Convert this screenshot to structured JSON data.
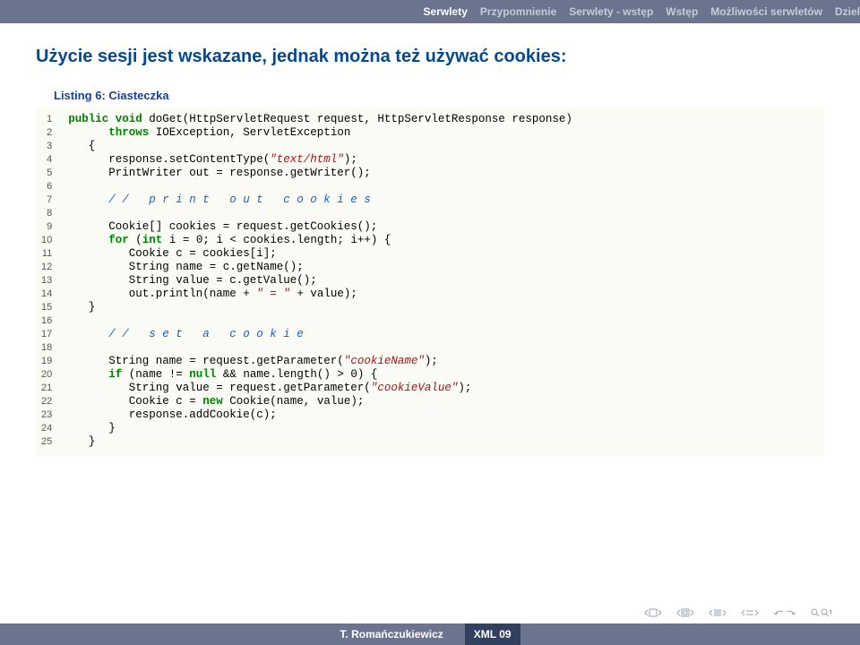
{
  "header": {
    "current": "Serwlety",
    "nav": [
      "Przypomnienie",
      "Serwlety - wstęp",
      "Wstęp",
      "Możliwości serwletów",
      "Dziel"
    ]
  },
  "slide": {
    "title": "Użycie sesji jest wskazane, jednak można też używać cookies:",
    "caption": "Listing 6: Ciasteczka"
  },
  "code": {
    "lines": [
      [
        [
          "kw",
          "public"
        ],
        [
          "tx",
          " "
        ],
        [
          "kw",
          "void"
        ],
        [
          "tx",
          " doGet(HttpServletRequest request, HttpServletResponse response)"
        ]
      ],
      [
        [
          "tx",
          "      "
        ],
        [
          "kw",
          "throws"
        ],
        [
          "tx",
          " IOException, ServletException"
        ]
      ],
      [
        [
          "tx",
          "   {"
        ]
      ],
      [
        [
          "tx",
          "      response.setContentType("
        ],
        [
          "str",
          "\"text/html\""
        ],
        [
          "tx",
          ");"
        ]
      ],
      [
        [
          "tx",
          "      PrintWriter out = response.getWriter();"
        ]
      ],
      [
        [
          "tx",
          ""
        ]
      ],
      [
        [
          "tx",
          "      "
        ],
        [
          "cmt",
          "// print out cookies"
        ]
      ],
      [
        [
          "tx",
          ""
        ]
      ],
      [
        [
          "tx",
          "      Cookie[] cookies = request.getCookies();"
        ]
      ],
      [
        [
          "tx",
          "      "
        ],
        [
          "kw",
          "for"
        ],
        [
          "tx",
          " ("
        ],
        [
          "kw",
          "int"
        ],
        [
          "tx",
          " i = 0; i < cookies.length; i++) {"
        ]
      ],
      [
        [
          "tx",
          "         Cookie c = cookies[i];"
        ]
      ],
      [
        [
          "tx",
          "         String name = c.getName();"
        ]
      ],
      [
        [
          "tx",
          "         String value = c.getValue();"
        ]
      ],
      [
        [
          "tx",
          "         out.println(name + "
        ],
        [
          "str",
          "\" = \""
        ],
        [
          "tx",
          " + value);"
        ]
      ],
      [
        [
          "tx",
          "   }"
        ]
      ],
      [
        [
          "tx",
          ""
        ]
      ],
      [
        [
          "tx",
          "      "
        ],
        [
          "cmt",
          "// set a cookie"
        ]
      ],
      [
        [
          "tx",
          ""
        ]
      ],
      [
        [
          "tx",
          "      String name = request.getParameter("
        ],
        [
          "str",
          "\"cookieName\""
        ],
        [
          "tx",
          ");"
        ]
      ],
      [
        [
          "tx",
          "      "
        ],
        [
          "kw",
          "if"
        ],
        [
          "tx",
          " (name != "
        ],
        [
          "kw",
          "null"
        ],
        [
          "tx",
          " && name.length() > 0) {"
        ]
      ],
      [
        [
          "tx",
          "         String value = request.getParameter("
        ],
        [
          "str",
          "\"cookieValue\""
        ],
        [
          "tx",
          ");"
        ]
      ],
      [
        [
          "tx",
          "         Cookie c = "
        ],
        [
          "kw",
          "new"
        ],
        [
          "tx",
          " Cookie(name, value);"
        ]
      ],
      [
        [
          "tx",
          "         response.addCookie(c);"
        ]
      ],
      [
        [
          "tx",
          "      }"
        ]
      ],
      [
        [
          "tx",
          "   }"
        ]
      ]
    ]
  },
  "footer": {
    "author": "T. Romańczukiewicz",
    "badge": "XML 09"
  }
}
